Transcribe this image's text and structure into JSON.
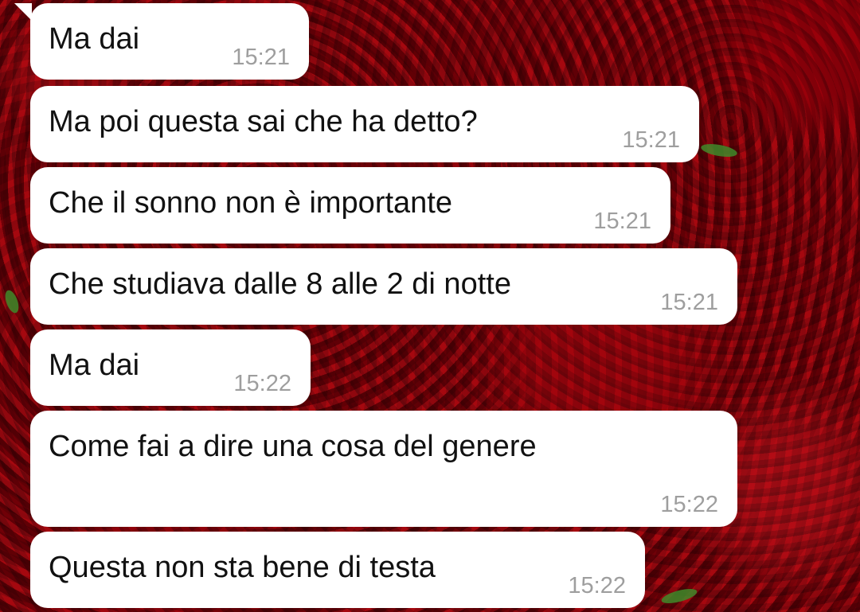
{
  "messages": [
    {
      "text": "Ma dai",
      "time": "15:21"
    },
    {
      "text": "Ma poi questa sai che ha detto?",
      "time": "15:21"
    },
    {
      "text": "Che il sonno non è importante",
      "time": "15:21"
    },
    {
      "text": "Che studiava dalle 8 alle 2 di notte",
      "time": "15:21"
    },
    {
      "text": "Ma dai",
      "time": "15:22"
    },
    {
      "text": "Come fai a dire una cosa del genere",
      "time": "15:22"
    },
    {
      "text": "Questa non sta bene di testa",
      "time": "15:22"
    }
  ],
  "colors": {
    "bubble": "#ffffff",
    "text": "#111111",
    "timestamp": "#9e9e9e",
    "wallpaper": "#8d0010"
  }
}
